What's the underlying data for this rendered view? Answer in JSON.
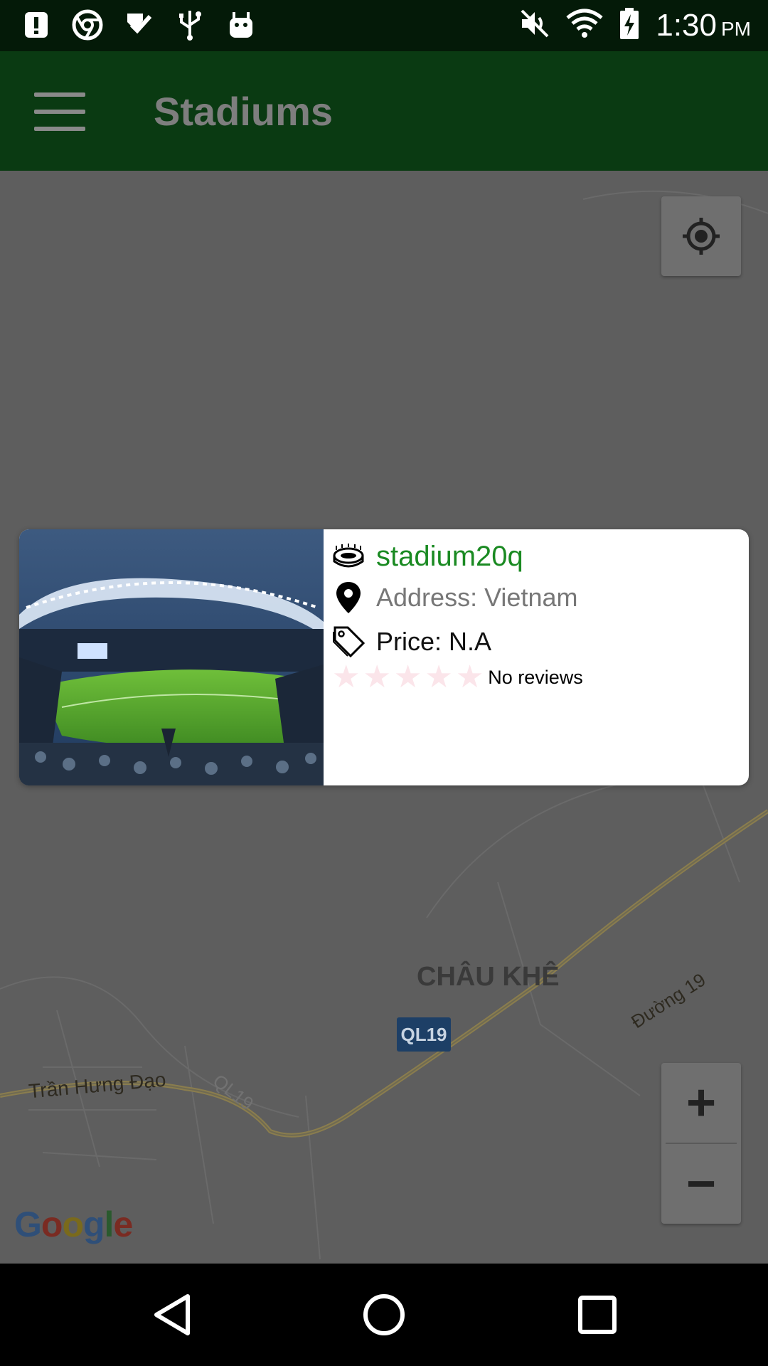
{
  "status_bar": {
    "time": "1:30",
    "ampm": "PM",
    "left_icons": [
      "alert-icon",
      "chrome-icon",
      "check-icon",
      "usb-icon",
      "android-icon"
    ],
    "right_icons": [
      "mute-icon",
      "wifi-icon",
      "battery-charging-icon"
    ]
  },
  "app_bar": {
    "title": "Stadiums",
    "menu_icon": "hamburger-menu-icon"
  },
  "map": {
    "region_label": "CHÂU KHÊ",
    "street_1": "Trần Hưng Đạo",
    "street_2": "Đường 19",
    "road_ghost": "QL19",
    "highway_shield": "QL19",
    "attribution": "Google",
    "controls": {
      "locate_icon": "my-location-icon",
      "zoom_in": "+",
      "zoom_out": "−"
    }
  },
  "info_card": {
    "name": "stadium20q",
    "address": "Address: Vietnam",
    "price": "Price: N.A",
    "rating": 0,
    "rating_max": 5,
    "reviews": "No reviews"
  },
  "nav_bar": {
    "items": [
      "back-icon",
      "home-icon",
      "recents-icon"
    ]
  }
}
